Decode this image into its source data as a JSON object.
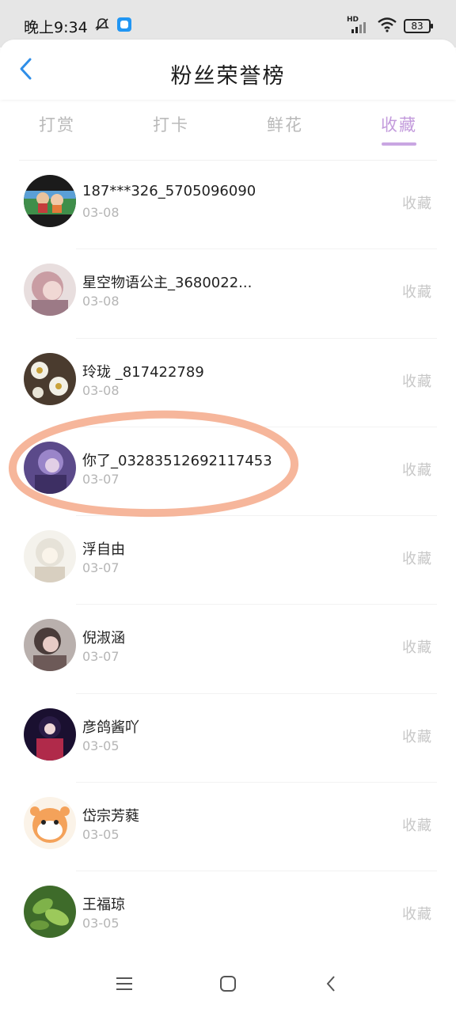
{
  "status_bar": {
    "time": "晚上9:34",
    "network": "HD",
    "battery": "83"
  },
  "header": {
    "title": "粉丝荣誉榜"
  },
  "tabs": [
    {
      "label": "打赏"
    },
    {
      "label": "打卡"
    },
    {
      "label": "鲜花"
    },
    {
      "label": "收藏"
    }
  ],
  "active_tab": "收藏",
  "fans": [
    {
      "name": "187***326_5705096090",
      "date": "03-08",
      "action": "收藏"
    },
    {
      "name": "星空物语公主_3680022...",
      "date": "03-08",
      "action": "收藏"
    },
    {
      "name": "玲珑 _817422789",
      "date": "03-08",
      "action": "收藏"
    },
    {
      "name": "你了_03283512692117453",
      "date": "03-07",
      "action": "收藏"
    },
    {
      "name": "浮自由",
      "date": "03-07",
      "action": "收藏"
    },
    {
      "name": "倪淑涵",
      "date": "03-07",
      "action": "收藏"
    },
    {
      "name": "彦鸽酱吖",
      "date": "03-05",
      "action": "收藏"
    },
    {
      "name": "岱宗芳蕤",
      "date": "03-05",
      "action": "收藏"
    },
    {
      "name": "王福琼",
      "date": "03-05",
      "action": "收藏"
    }
  ],
  "colors": {
    "accent": "#c39bdc",
    "highlight_annotation": "#f4a98a"
  }
}
